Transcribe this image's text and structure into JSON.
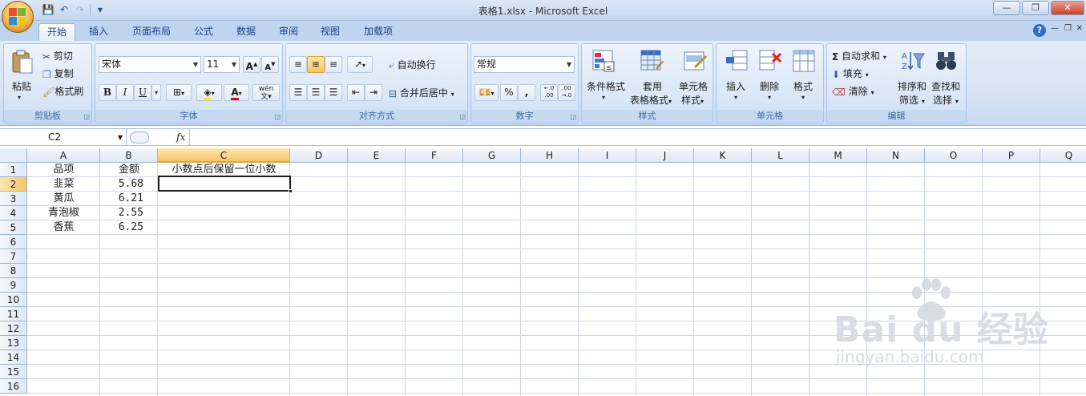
{
  "window": {
    "title": "表格1.xlsx - Microsoft Excel",
    "controls": {
      "minimize": "—",
      "restore": "❐",
      "close": "✕"
    }
  },
  "qat": {
    "save": "💾",
    "undo": "↶",
    "redo": "↷",
    "customize": "▾"
  },
  "tabs": [
    "开始",
    "插入",
    "页面布局",
    "公式",
    "数据",
    "审阅",
    "视图",
    "加载项"
  ],
  "active_tab": "开始",
  "help": "?",
  "ribbon": {
    "clipboard": {
      "label": "剪贴板",
      "paste": "粘贴",
      "cut": "剪切",
      "copy": "复制",
      "format_painter": "格式刷"
    },
    "font": {
      "label": "字体",
      "font_name": "宋体",
      "font_size": "11",
      "grow": "A",
      "shrink": "A",
      "bold": "B",
      "italic": "I",
      "underline": "U",
      "font_color": "A",
      "phonetic": "wén"
    },
    "alignment": {
      "label": "对齐方式",
      "wrap": "自动换行",
      "merge": "合并后居中"
    },
    "number": {
      "label": "数字",
      "format": "常规",
      "percent": "%",
      "comma": ",",
      "inc_dec": "←.0\n.00",
      "dec_dec": ".00\n→.0"
    },
    "styles": {
      "label": "样式",
      "conditional": "条件格式",
      "table_line1": "套用",
      "table_line2": "表格格式",
      "cell_line1": "单元格",
      "cell_line2": "样式"
    },
    "cells": {
      "label": "单元格",
      "insert": "插入",
      "delete": "删除",
      "format": "格式"
    },
    "editing": {
      "label": "编辑",
      "autosum": "自动求和",
      "fill": "填充",
      "clear": "清除",
      "sort_line1": "排序和",
      "sort_line2": "筛选",
      "find_line1": "查找和",
      "find_line2": "选择"
    }
  },
  "formula_bar": {
    "name_box": "C2",
    "fx": "fx",
    "content": ""
  },
  "sheet": {
    "columns": [
      "A",
      "B",
      "C",
      "D",
      "E",
      "F",
      "G",
      "H",
      "I",
      "J",
      "K",
      "L",
      "M",
      "N",
      "O",
      "P",
      "Q"
    ],
    "rows": [
      "1",
      "2",
      "3",
      "4",
      "5",
      "6",
      "7",
      "8",
      "9",
      "10",
      "11",
      "12",
      "13",
      "14",
      "15",
      "16"
    ],
    "selected_cell": "C2",
    "cells": {
      "A1": "品项",
      "B1": "金额",
      "C1": "小数点后保留一位小数",
      "A2": "韭菜",
      "B2": "5.68",
      "A3": "黄瓜",
      "B3": "6.21",
      "A4": "青泡椒",
      "B4": "2.55",
      "A5": "香蕉",
      "B5": "6.25"
    }
  },
  "watermark": {
    "main": "Bai du 经验",
    "sub": "jingyan.baidu.com"
  }
}
